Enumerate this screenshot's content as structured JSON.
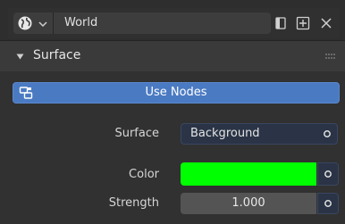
{
  "header": {
    "world_name": "World",
    "world_type_icon": "world-globe-icon",
    "fake_user_icon": "fake-user-icon",
    "new_icon": "new-datablock-icon",
    "close_icon": "close-icon"
  },
  "panel": {
    "title": "Surface",
    "use_nodes_label": "Use Nodes",
    "use_nodes_color": "#4a7ac2"
  },
  "properties": {
    "surface_label": "Surface",
    "surface_value": "Background",
    "color_label": "Color",
    "color_value": "#00ff00",
    "strength_label": "Strength",
    "strength_value": "1.000"
  }
}
